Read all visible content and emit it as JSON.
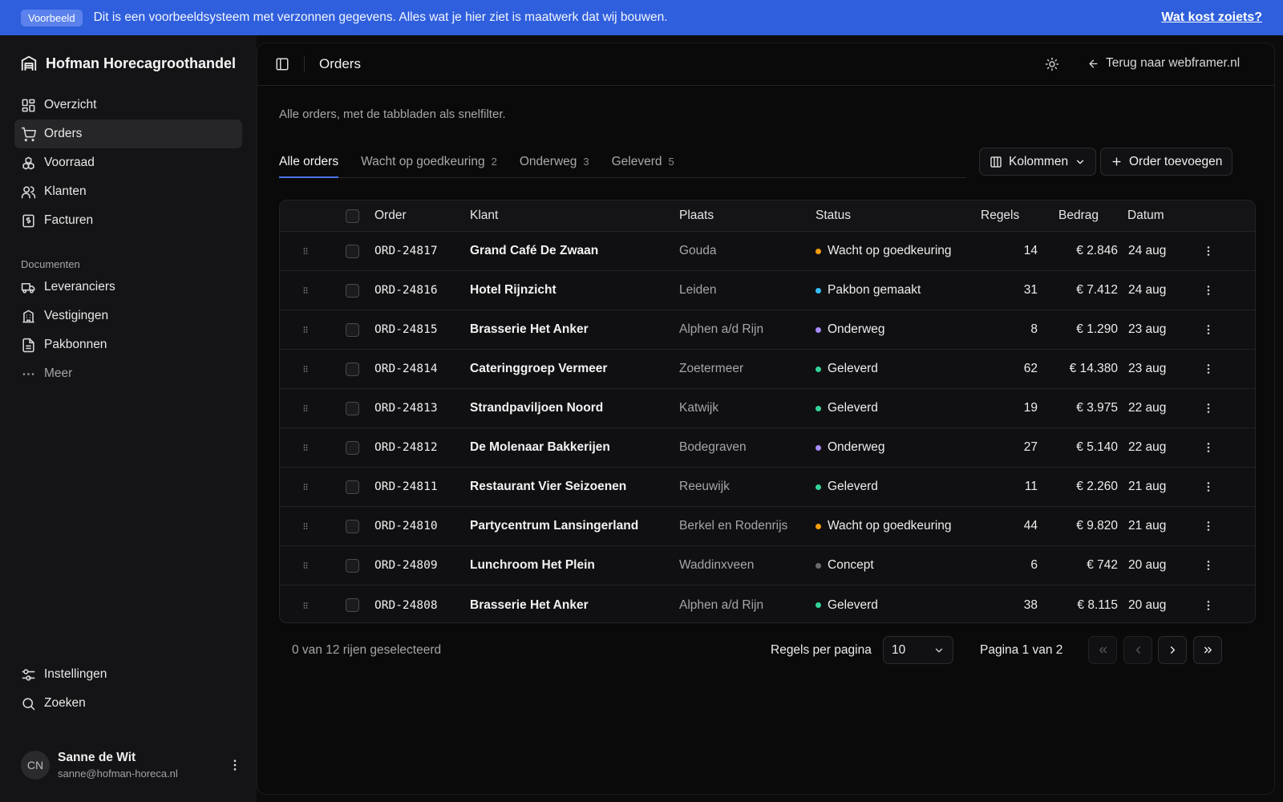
{
  "banner": {
    "badge": "Voorbeeld",
    "text": "Dit is een voorbeeldsysteem met verzonnen gegevens. Alles wat je hier ziet is maatwerk dat wij bouwen.",
    "link": "Wat kost zoiets?"
  },
  "sidebar": {
    "brand": "Hofman Horecagroothandel",
    "main_items": [
      {
        "label": "Overzicht",
        "icon": "grid-icon"
      },
      {
        "label": "Orders",
        "icon": "cart-icon",
        "active": true
      },
      {
        "label": "Voorraad",
        "icon": "boxes-icon"
      },
      {
        "label": "Klanten",
        "icon": "users-icon"
      },
      {
        "label": "Facturen",
        "icon": "invoice-icon"
      }
    ],
    "section_label": "Documenten",
    "doc_items": [
      {
        "label": "Leveranciers",
        "icon": "truck-icon"
      },
      {
        "label": "Vestigingen",
        "icon": "building-icon"
      },
      {
        "label": "Pakbonnen",
        "icon": "file-icon"
      },
      {
        "label": "Meer",
        "icon": "ellipsis-icon"
      }
    ],
    "bottom_items": [
      {
        "label": "Instellingen",
        "icon": "sliders-icon"
      },
      {
        "label": "Zoeken",
        "icon": "search-icon"
      }
    ],
    "user": {
      "initials": "CN",
      "name": "Sanne de Wit",
      "email": "sanne@hofman-horeca.nl"
    }
  },
  "header": {
    "title": "Orders",
    "back_link": "Terug naar webframer.nl"
  },
  "page": {
    "subtitle": "Alle orders, met de tabbladen als snelfilter.",
    "tabs": [
      {
        "label": "Alle orders",
        "count": "",
        "active": true
      },
      {
        "label": "Wacht op goedkeuring",
        "count": "2"
      },
      {
        "label": "Onderweg",
        "count": "3"
      },
      {
        "label": "Geleverd",
        "count": "5"
      }
    ],
    "columns_button": "Kolommen",
    "add_button": "Order toevoegen"
  },
  "table": {
    "headers": {
      "order": "Order",
      "klant": "Klant",
      "plaats": "Plaats",
      "status": "Status",
      "regels": "Regels",
      "bedrag": "Bedrag",
      "datum": "Datum"
    },
    "rows": [
      {
        "order": "ORD-24817",
        "klant": "Grand Café De Zwaan",
        "plaats": "Gouda",
        "status": "Wacht op goedkeuring",
        "status_color": "#f59e0b",
        "regels": "14",
        "bedrag": "€ 2.846",
        "datum": "24 aug"
      },
      {
        "order": "ORD-24816",
        "klant": "Hotel Rijnzicht",
        "plaats": "Leiden",
        "status": "Pakbon gemaakt",
        "status_color": "#38bdf8",
        "regels": "31",
        "bedrag": "€ 7.412",
        "datum": "24 aug"
      },
      {
        "order": "ORD-24815",
        "klant": "Brasserie Het Anker",
        "plaats": "Alphen a/d Rijn",
        "status": "Onderweg",
        "status_color": "#a78bfa",
        "regels": "8",
        "bedrag": "€ 1.290",
        "datum": "23 aug"
      },
      {
        "order": "ORD-24814",
        "klant": "Cateringgroep Vermeer",
        "plaats": "Zoetermeer",
        "status": "Geleverd",
        "status_color": "#34d399",
        "regels": "62",
        "bedrag": "€ 14.380",
        "datum": "23 aug"
      },
      {
        "order": "ORD-24813",
        "klant": "Strandpaviljoen Noord",
        "plaats": "Katwijk",
        "status": "Geleverd",
        "status_color": "#34d399",
        "regels": "19",
        "bedrag": "€ 3.975",
        "datum": "22 aug"
      },
      {
        "order": "ORD-24812",
        "klant": "De Molenaar Bakkerijen",
        "plaats": "Bodegraven",
        "status": "Onderweg",
        "status_color": "#a78bfa",
        "regels": "27",
        "bedrag": "€ 5.140",
        "datum": "22 aug"
      },
      {
        "order": "ORD-24811",
        "klant": "Restaurant Vier Seizoenen",
        "plaats": "Reeuwijk",
        "status": "Geleverd",
        "status_color": "#34d399",
        "regels": "11",
        "bedrag": "€ 2.260",
        "datum": "21 aug"
      },
      {
        "order": "ORD-24810",
        "klant": "Partycentrum Lansingerland",
        "plaats": "Berkel en Rodenrijs",
        "status": "Wacht op goedkeuring",
        "status_color": "#f59e0b",
        "regels": "44",
        "bedrag": "€ 9.820",
        "datum": "21 aug"
      },
      {
        "order": "ORD-24809",
        "klant": "Lunchroom Het Plein",
        "plaats": "Waddinxveen",
        "status": "Concept",
        "status_color": "#6b6b70",
        "regels": "6",
        "bedrag": "€ 742",
        "datum": "20 aug"
      },
      {
        "order": "ORD-24808",
        "klant": "Brasserie Het Anker",
        "plaats": "Alphen a/d Rijn",
        "status": "Geleverd",
        "status_color": "#34d399",
        "regels": "38",
        "bedrag": "€ 8.115",
        "datum": "20 aug"
      }
    ]
  },
  "footer": {
    "selection": "0 van 12 rijen geselecteerd",
    "per_page_label": "Regels per pagina",
    "per_page_value": "10",
    "page_info": "Pagina 1 van 2"
  }
}
